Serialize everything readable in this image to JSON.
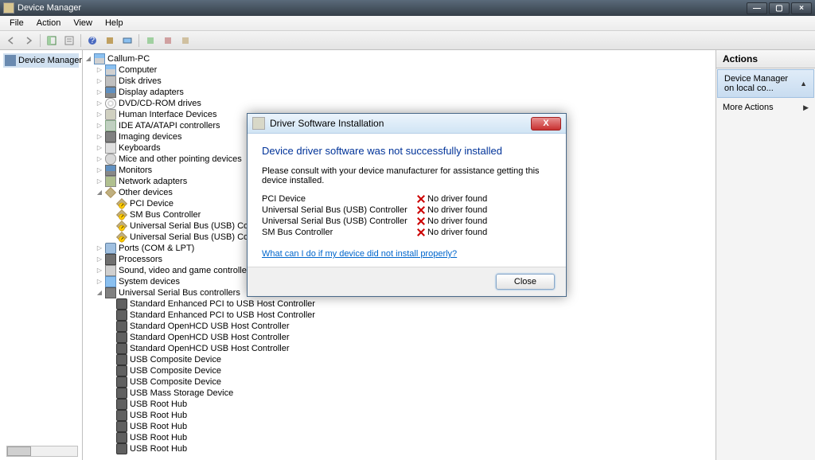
{
  "window": {
    "title": "Device Manager",
    "min": "—",
    "max": "▢",
    "close": "×"
  },
  "menubar": [
    "File",
    "Action",
    "View",
    "Help"
  ],
  "left_nav": {
    "label": "Device Manager on"
  },
  "actions_pane": {
    "header": "Actions",
    "selected": "Device Manager on local co...",
    "more": "More Actions"
  },
  "tree": {
    "root": "Callum-PC",
    "nodes": [
      {
        "label": "Computer",
        "icon": "icon-computer",
        "exp": "▷"
      },
      {
        "label": "Disk drives",
        "icon": "icon-drive",
        "exp": "▷"
      },
      {
        "label": "Display adapters",
        "icon": "icon-monitor",
        "exp": "▷"
      },
      {
        "label": "DVD/CD-ROM drives",
        "icon": "icon-disc",
        "exp": "▷"
      },
      {
        "label": "Human Interface Devices",
        "icon": "icon-hid",
        "exp": "▷"
      },
      {
        "label": "IDE ATA/ATAPI controllers",
        "icon": "icon-ata",
        "exp": "▷"
      },
      {
        "label": "Imaging devices",
        "icon": "icon-imaging",
        "exp": "▷"
      },
      {
        "label": "Keyboards",
        "icon": "icon-keyboard",
        "exp": "▷"
      },
      {
        "label": "Mice and other pointing devices",
        "icon": "icon-mouse",
        "exp": "▷"
      },
      {
        "label": "Monitors",
        "icon": "icon-monitor",
        "exp": "▷"
      },
      {
        "label": "Network adapters",
        "icon": "icon-network",
        "exp": "▷"
      },
      {
        "label": "Other devices",
        "icon": "icon-other",
        "exp": "◢",
        "children": [
          {
            "label": "PCI Device",
            "icon": "icon-other icon-warning"
          },
          {
            "label": "SM Bus Controller",
            "icon": "icon-other icon-warning"
          },
          {
            "label": "Universal Serial Bus (USB) Controller",
            "icon": "icon-other icon-warning"
          },
          {
            "label": "Universal Serial Bus (USB) Controller",
            "icon": "icon-other icon-warning"
          }
        ]
      },
      {
        "label": "Ports (COM & LPT)",
        "icon": "icon-port",
        "exp": "▷"
      },
      {
        "label": "Processors",
        "icon": "icon-cpu",
        "exp": "▷"
      },
      {
        "label": "Sound, video and game controllers",
        "icon": "icon-sound",
        "exp": "▷"
      },
      {
        "label": "System devices",
        "icon": "icon-system",
        "exp": "▷"
      },
      {
        "label": "Universal Serial Bus controllers",
        "icon": "icon-usb",
        "exp": "◢",
        "children": [
          {
            "label": "Standard Enhanced PCI to USB Host Controller",
            "icon": "icon-usbdev"
          },
          {
            "label": "Standard Enhanced PCI to USB Host Controller",
            "icon": "icon-usbdev"
          },
          {
            "label": "Standard OpenHCD USB Host Controller",
            "icon": "icon-usbdev"
          },
          {
            "label": "Standard OpenHCD USB Host Controller",
            "icon": "icon-usbdev"
          },
          {
            "label": "Standard OpenHCD USB Host Controller",
            "icon": "icon-usbdev"
          },
          {
            "label": "USB Composite Device",
            "icon": "icon-usbdev"
          },
          {
            "label": "USB Composite Device",
            "icon": "icon-usbdev"
          },
          {
            "label": "USB Composite Device",
            "icon": "icon-usbdev"
          },
          {
            "label": "USB Mass Storage Device",
            "icon": "icon-usbdev"
          },
          {
            "label": "USB Root Hub",
            "icon": "icon-usbdev"
          },
          {
            "label": "USB Root Hub",
            "icon": "icon-usbdev"
          },
          {
            "label": "USB Root Hub",
            "icon": "icon-usbdev"
          },
          {
            "label": "USB Root Hub",
            "icon": "icon-usbdev"
          },
          {
            "label": "USB Root Hub",
            "icon": "icon-usbdev"
          }
        ]
      }
    ]
  },
  "dialog": {
    "title": "Driver Software Installation",
    "heading": "Device driver software was not successfully installed",
    "desc": "Please consult with your device manufacturer for assistance getting this device installed.",
    "devices": [
      {
        "name": "PCI Device",
        "status": "No driver found"
      },
      {
        "name": "Universal Serial Bus (USB) Controller",
        "status": "No driver found"
      },
      {
        "name": "Universal Serial Bus (USB) Controller",
        "status": "No driver found"
      },
      {
        "name": "SM Bus Controller",
        "status": "No driver found"
      }
    ],
    "link": "What can I do if my device did not install properly?",
    "close_btn": "Close",
    "x": "X"
  }
}
